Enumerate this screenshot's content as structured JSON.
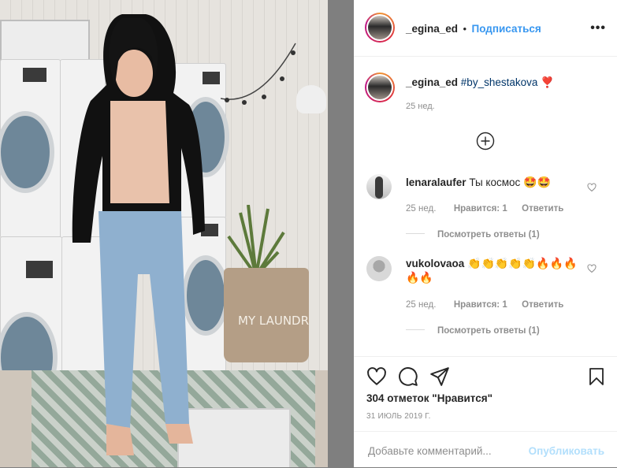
{
  "post": {
    "username": "_egina_ed",
    "follow_label": "Подписаться",
    "separator": "•",
    "more_label": "•••"
  },
  "caption": {
    "username": "_egina_ed",
    "hashtag": "#by_shestakova",
    "emoji": "❣️",
    "time": "25 нед."
  },
  "load_more_icon": "plus-circle-icon",
  "comments": [
    {
      "username": "lenaralaufer",
      "text": "Ты космос",
      "emoji": "🤩🤩",
      "time": "25 нед.",
      "likes": "Нравится: 1",
      "reply": "Ответить",
      "view_replies": "Посмотреть ответы (1)"
    },
    {
      "username": "vukolovaoa",
      "text": "",
      "emoji": "👏👏👏👏👏🔥🔥🔥🔥🔥",
      "time": "25 нед.",
      "likes": "Нравится: 1",
      "reply": "Ответить",
      "view_replies": "Посмотреть ответы (1)"
    }
  ],
  "photo_text": "MY LAUNDR",
  "likes_text": "304 отметок \"Нравится\"",
  "date_text": "31 ИЮЛЬ 2019 Г.",
  "comment_placeholder": "Добавьте комментарий...",
  "publish_label": "Опубликовать",
  "icons": [
    "heart-icon",
    "comment-icon",
    "share-icon",
    "bookmark-icon",
    "more-icon"
  ],
  "colors": {
    "link": "#3897f0",
    "publish_disabled": "#b2dffc",
    "meta": "#8e8e8e",
    "overlay": "#7f7f7f"
  }
}
